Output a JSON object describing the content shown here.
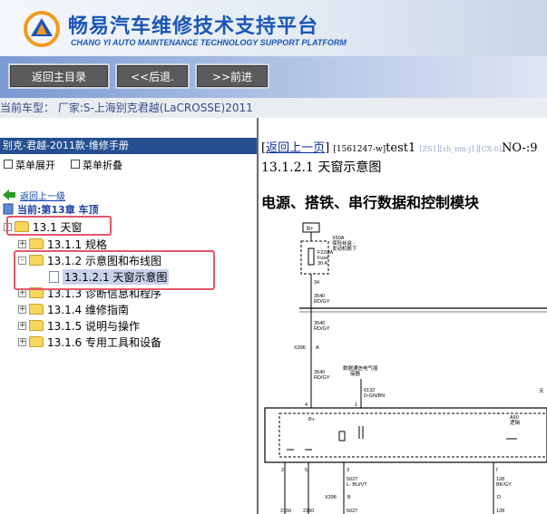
{
  "header": {
    "title_cn": "畅易汽车维修技术支持平台",
    "title_en": "CHANG YI AUTO MAINTENANCE TECHNOLOGY SUPPORT PLATFORM",
    "logo_icon": "cy-logo-icon"
  },
  "toolbar": {
    "main_label": "返回主目录",
    "back_label": "<<后退.",
    "forward_label": ">>前进"
  },
  "info": {
    "current_model": "当前车型：  厂家:S-上海别克君越(LaCROSSE)2011"
  },
  "left": {
    "manual_title": "别克-君越-2011款-维修手册",
    "expand_label": "菜单展开",
    "collapse_label": "菜单折叠",
    "back_label": "返回上一级",
    "current_label": "当前:第13章 车顶",
    "tree": [
      {
        "label": "13.1 天窗",
        "level": 0,
        "type": "folder",
        "toggle": "-"
      },
      {
        "label": "13.1.1 规格",
        "level": 1,
        "type": "folder",
        "toggle": "+"
      },
      {
        "label": "13.1.2 示意图和布线图",
        "level": 1,
        "type": "folder",
        "toggle": "-"
      },
      {
        "label": "13.1.2.1 天窗示意图",
        "level": 2,
        "type": "doc",
        "toggle": ""
      },
      {
        "label": "13.1.3 诊断信息和程序",
        "level": 1,
        "type": "folder",
        "toggle": "+"
      },
      {
        "label": "13.1.4 维修指南",
        "level": 1,
        "type": "folder",
        "toggle": "+"
      },
      {
        "label": "13.1.5 说明与操作",
        "level": 1,
        "type": "folder",
        "toggle": "+"
      },
      {
        "label": "13.1.6 专用工具和设备",
        "level": 1,
        "type": "folder",
        "toggle": "+"
      }
    ]
  },
  "right": {
    "back_link": "返回上一页",
    "doc_id": "[1561247-w]",
    "doc_name": "test1",
    "codes": "[ZS1][zh_nm-j1][CX-0]",
    "page_no": "NO-:9",
    "section_title": "13.1.2.1 天窗示意图",
    "subtitle": "电源、搭铁、串行数据和控制模块"
  },
  "diagram": {
    "b_plus": "B+",
    "fuse_note1": "X50A",
    "fuse_note2": "保险丝盒 -",
    "fuse_note3": "发动机舱下",
    "fuse_code": "F22UA",
    "fuse_name": "Fuse",
    "fuse_amp": "30 A",
    "w34": "34",
    "w3540a": "3540",
    "rdgy_a": "RD/GY",
    "w3540b": "3540",
    "rdgy_b": "RD/GY",
    "conn_x396": "X396",
    "pin_a": "A",
    "w3540c": "3540",
    "rdgy_c": "RD/GY",
    "data_link1": "数据通信电气插",
    "data_link2": "接器",
    "w6132": "6132",
    "dgnbn": "D-GN/BN",
    "pin_4": "4",
    "pin_1": "1",
    "bplus_box": "B+",
    "mod_a90": "A90",
    "mod_name": "逻辑",
    "side_label": "天",
    "pin_2": "2",
    "pin_5": "5",
    "pin_3": "3",
    "pin_7": "7",
    "w5027": "5027",
    "lbuvt": "L- BU/VT",
    "w128": "128",
    "bkgy": "BK/GY",
    "conn_x398": "X398",
    "pin_b": "B",
    "pin_d": "D",
    "w2150a": "2150",
    "w2150b": "2150",
    "w5027b": "5027",
    "w128b": "128"
  }
}
